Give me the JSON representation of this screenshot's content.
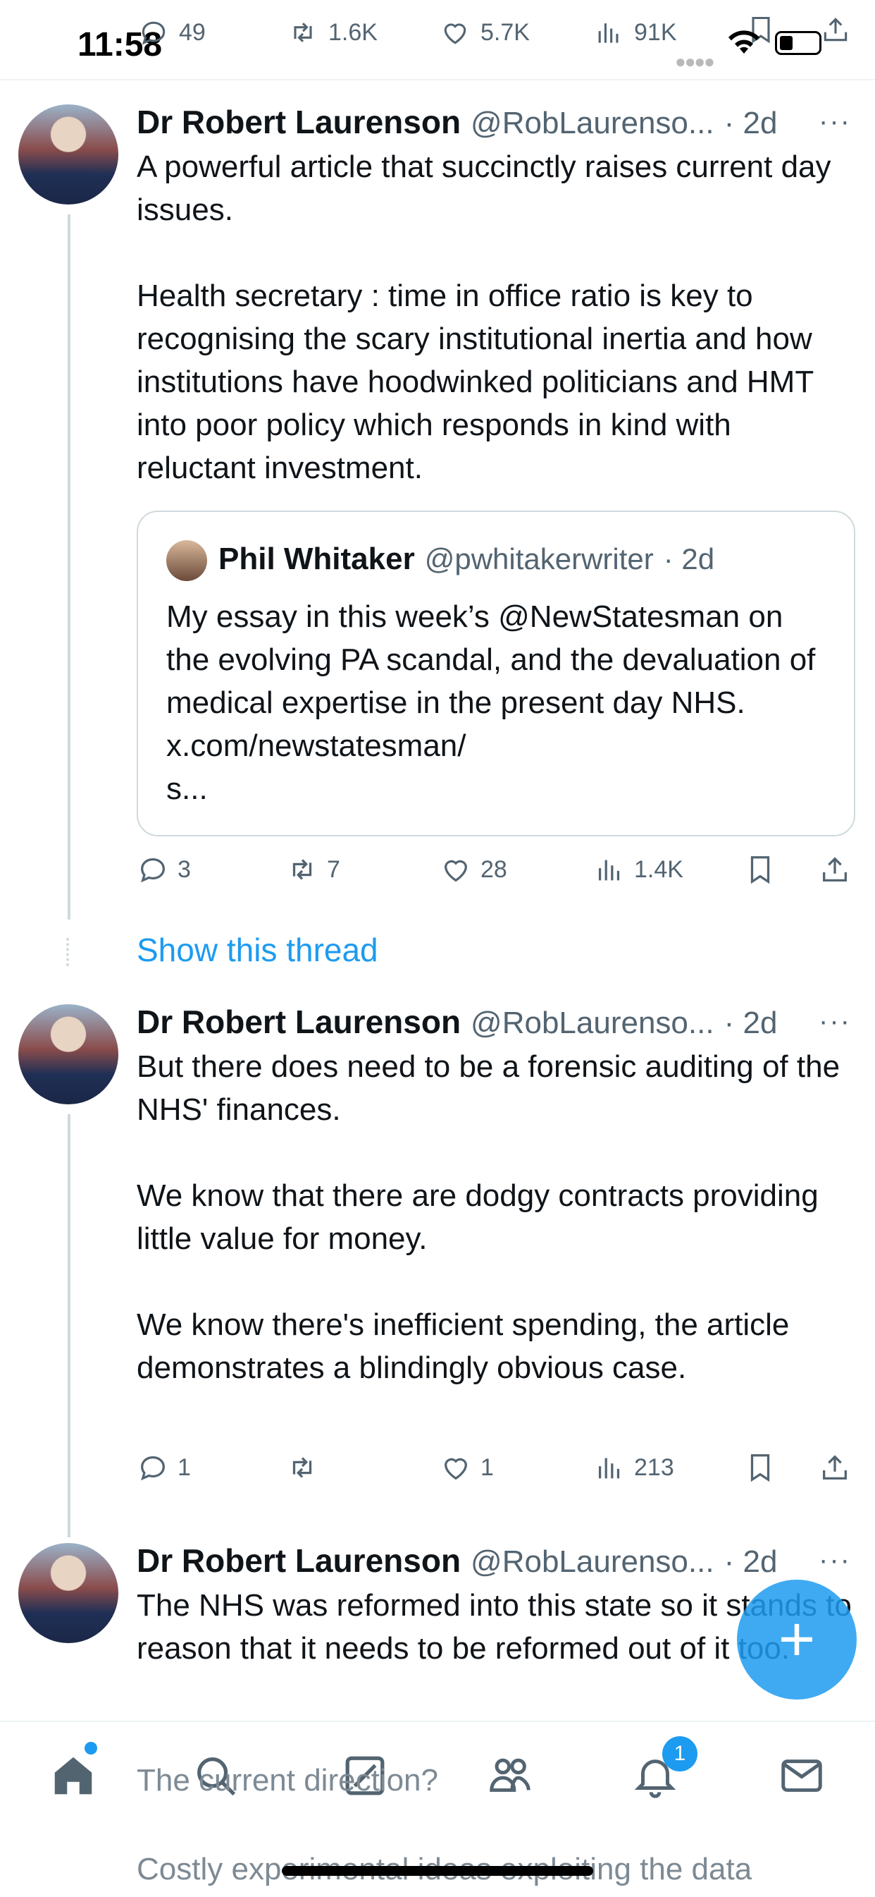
{
  "status_bar": {
    "time": "11:58"
  },
  "top_action_bar": {
    "replies": "49",
    "reposts": "1.6K",
    "likes": "5.7K",
    "views": "91K"
  },
  "tweets": [
    {
      "author_name": "Dr Robert Laurenson",
      "author_handle": "@RobLaurenso...",
      "time": "· 2d",
      "text": "A powerful article that succinctly raises current day issues.\n\nHealth secretary : time in office ratio is key to recognising the scary institutional inertia and how institutions have hoodwinked politicians and HMT into poor policy which responds in kind with reluctant investment.",
      "quote": {
        "author_name": "Phil Whitaker",
        "author_handle": "@pwhitakerwriter",
        "time": "· 2d",
        "text": "My essay in this week’s @NewStatesman on the evolving PA scandal, and the devaluation of medical expertise in the present day NHS. x.com/newstatesman/\ns..."
      },
      "replies": "3",
      "reposts": "7",
      "likes": "28",
      "views": "1.4K"
    },
    {
      "author_name": "Dr Robert Laurenson",
      "author_handle": "@RobLaurenso...",
      "time": "· 2d",
      "text": "But there does need to be a forensic auditing of the NHS' finances.\n\nWe know that there are dodgy contracts providing little value for money.\n\nWe know there's inefficient spending, the article demonstrates a blindingly obvious case.",
      "replies": "1",
      "reposts": "",
      "likes": "1",
      "views": "213"
    },
    {
      "author_name": "Dr Robert Laurenson",
      "author_handle": "@RobLaurenso...",
      "time": "· 2d",
      "text": "The NHS was reformed into this state so it stands to reason that it needs to be reformed out of it too.",
      "faded_lines": [
        "The current direction?",
        "Costly experimental ideas exploiting the data"
      ]
    }
  ],
  "show_thread_label": "Show this thread",
  "more_label": "···",
  "fab_label": "+",
  "tabbar": {
    "notifications_badge": "1"
  },
  "colors": {
    "accent": "#1d9bf0",
    "text": "#0f1419",
    "muted": "#536471"
  }
}
